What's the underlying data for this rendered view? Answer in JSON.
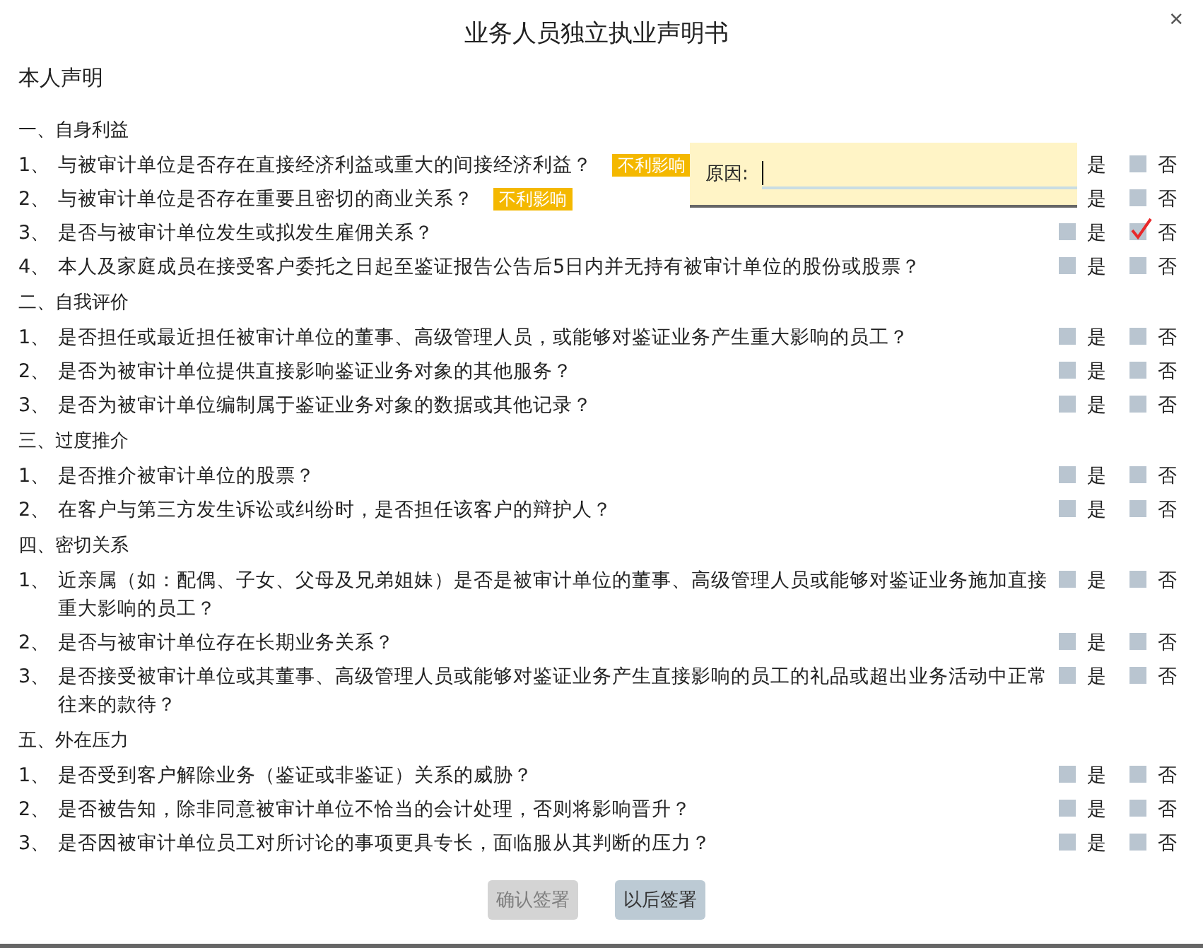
{
  "dialog": {
    "title": "业务人员独立执业声明书",
    "close": "×",
    "subtitle": "本人声明"
  },
  "sections": [
    {
      "heading": "一、自身利益",
      "items": [
        {
          "number": "1、",
          "text": "与被审计单位是否存在直接经济利益或重大的间接经济利益？",
          "tag": "不利影响",
          "yes": {
            "label": "是"
          },
          "no": {
            "label": "否",
            "checked": false
          }
        },
        {
          "number": "2、",
          "text": "与被审计单位是否存在重要且密切的商业关系？",
          "tag": "不利影响",
          "yes": {
            "label": "是"
          },
          "no": {
            "label": "否",
            "checked": false
          }
        },
        {
          "number": "3、",
          "text": "是否与被审计单位发生或拟发生雇佣关系？",
          "yes": {
            "label": "是",
            "checked": false
          },
          "no": {
            "label": "否",
            "checked": true
          }
        },
        {
          "number": "4、",
          "text": "本人及家庭成员在接受客户委托之日起至鉴证报告公告后5日内并无持有被审计单位的股份或股票？",
          "yes": {
            "label": "是",
            "checked": false
          },
          "no": {
            "label": "否",
            "checked": false
          }
        }
      ]
    },
    {
      "heading": "二、自我评价",
      "items": [
        {
          "number": "1、",
          "text": "是否担任或最近担任被审计单位的董事、高级管理人员，或能够对鉴证业务产生重大影响的员工？",
          "yes": {
            "label": "是",
            "checked": false
          },
          "no": {
            "label": "否",
            "checked": false
          }
        },
        {
          "number": "2、",
          "text": "是否为被审计单位提供直接影响鉴证业务对象的其他服务？",
          "yes": {
            "label": "是",
            "checked": false
          },
          "no": {
            "label": "否",
            "checked": false
          }
        },
        {
          "number": "3、",
          "text": "是否为被审计单位编制属于鉴证业务对象的数据或其他记录？",
          "yes": {
            "label": "是",
            "checked": false
          },
          "no": {
            "label": "否",
            "checked": false
          }
        }
      ]
    },
    {
      "heading": "三、过度推介",
      "items": [
        {
          "number": "1、",
          "text": "是否推介被审计单位的股票？",
          "yes": {
            "label": "是",
            "checked": false
          },
          "no": {
            "label": "否",
            "checked": false
          }
        },
        {
          "number": "2、",
          "text": "在客户与第三方发生诉讼或纠纷时，是否担任该客户的辩护人？",
          "yes": {
            "label": "是",
            "checked": false
          },
          "no": {
            "label": "否",
            "checked": false
          }
        }
      ]
    },
    {
      "heading": "四、密切关系",
      "items": [
        {
          "number": "1、",
          "text": "近亲属（如：配偶、子女、父母及兄弟姐妹）是否是被审计单位的董事、高级管理人员或能够对鉴证业务施加直接重大影响的员工？",
          "yes": {
            "label": "是",
            "checked": false
          },
          "no": {
            "label": "否",
            "checked": false
          }
        },
        {
          "number": "2、",
          "text": "是否与被审计单位存在长期业务关系？",
          "yes": {
            "label": "是",
            "checked": false
          },
          "no": {
            "label": "否",
            "checked": false
          }
        },
        {
          "number": "3、",
          "text": "是否接受被审计单位或其董事、高级管理人员或能够对鉴证业务产生直接影响的员工的礼品或超出业务活动中正常往来的款待？",
          "yes": {
            "label": "是",
            "checked": false
          },
          "no": {
            "label": "否",
            "checked": false
          }
        }
      ]
    },
    {
      "heading": "五、外在压力",
      "items": [
        {
          "number": "1、",
          "text": "是否受到客户解除业务（鉴证或非鉴证）关系的威胁？",
          "yes": {
            "label": "是",
            "checked": false
          },
          "no": {
            "label": "否",
            "checked": false
          }
        },
        {
          "number": "2、",
          "text": "是否被告知，除非同意被审计单位不恰当的会计处理，否则将影响晋升？",
          "yes": {
            "label": "是",
            "checked": false
          },
          "no": {
            "label": "否",
            "checked": false
          }
        },
        {
          "number": "3、",
          "text": "是否因被审计单位员工对所讨论的事项更具专长，面临服从其判断的压力？",
          "yes": {
            "label": "是",
            "checked": false
          },
          "no": {
            "label": "否",
            "checked": false
          }
        }
      ]
    }
  ],
  "reason_popup": {
    "label": "原因:"
  },
  "buttons": [
    {
      "label": "确认签署",
      "disabled": true
    },
    {
      "label": "以后签署",
      "disabled": false
    }
  ]
}
